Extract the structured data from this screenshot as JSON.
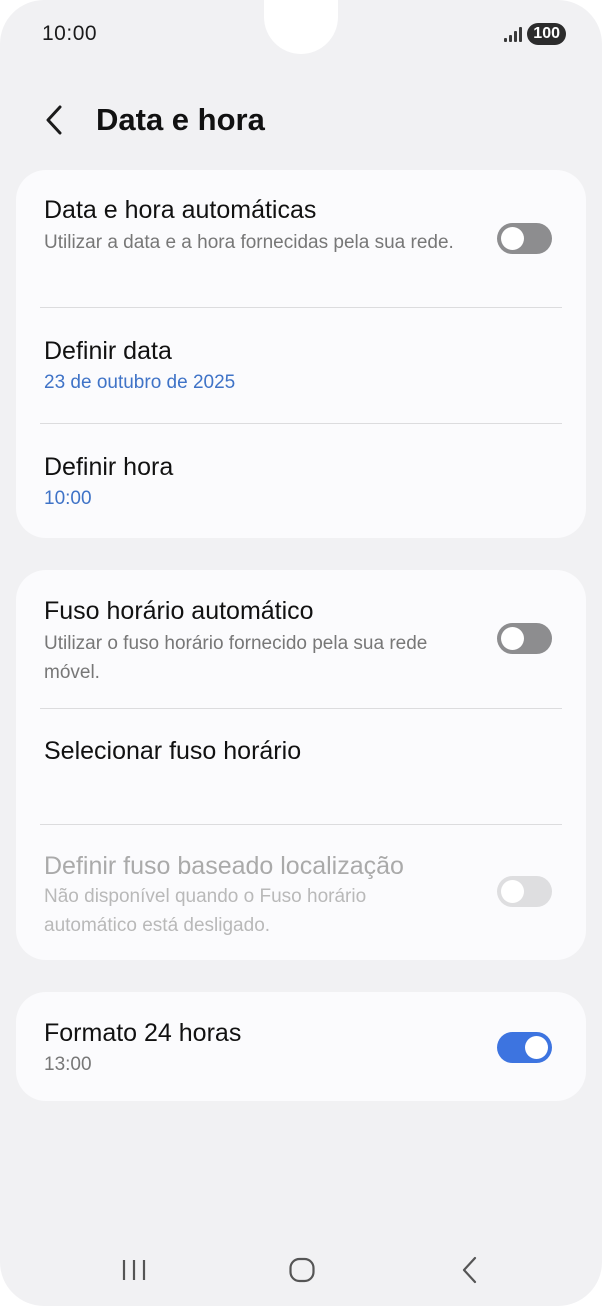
{
  "status_bar": {
    "time": "10:00",
    "battery": "100"
  },
  "header": {
    "title": "Data e hora"
  },
  "card1": {
    "auto_datetime": {
      "title": "Data e hora automáticas",
      "subtitle": "Utilizar a data e a hora fornecidas pela sua rede.",
      "enabled": false
    },
    "set_date": {
      "title": "Definir data",
      "value": "23 de outubro de 2025"
    },
    "set_time": {
      "title": "Definir hora",
      "value": "10:00"
    }
  },
  "card2": {
    "auto_timezone": {
      "title": "Fuso horário automático",
      "subtitle": "Utilizar o fuso horário fornecido pela sua rede móvel.",
      "enabled": false
    },
    "select_timezone": {
      "title": "Selecionar fuso horário"
    },
    "location_timezone": {
      "title": "Definir fuso baseado localização",
      "subtitle": "Não disponível quando o Fuso horário automático está desligado.",
      "enabled": false,
      "available": false
    }
  },
  "card3": {
    "format24": {
      "title": "Formato 24 horas",
      "subtitle": "13:00",
      "enabled": true
    }
  },
  "colors": {
    "accent": "#3d74e0",
    "link_blue": "#3f73c7",
    "background": "#f1f1f3"
  }
}
